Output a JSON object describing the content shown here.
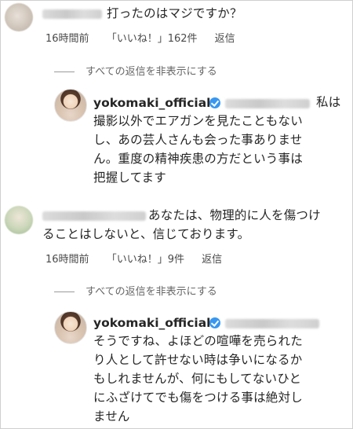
{
  "comments": [
    {
      "text": "打ったのはマジですか？",
      "time": "16時間前",
      "likes": "「いいね！」162件",
      "reply_label": "返信",
      "hide_replies": "すべての返信を非表示にする",
      "reply": {
        "username": "yokomaki_official",
        "lines": [
          "私は",
          "撮影以外でエアガンを見たこともない",
          "し、あの芸人さんも会った事ありませ",
          "ん。重度の精神疾患の方だという事は",
          "把握してます"
        ]
      }
    },
    {
      "lines": [
        "あなたは、物理的に人を傷つけ",
        "ることはしないと、信じております。"
      ],
      "time": "16時間前",
      "likes": "「いいね！」9件",
      "reply_label": "返信",
      "hide_replies": "すべての返信を非表示にする",
      "reply": {
        "username": "yokomaki_official",
        "lines": [
          "そうですね、よほどの喧嘩を売られた",
          "り人として許せない時は争いになるか",
          "もしれませんが、何にもしてないひと",
          "にふざけてでも傷をつける事は絶対し",
          "ません"
        ]
      }
    }
  ]
}
